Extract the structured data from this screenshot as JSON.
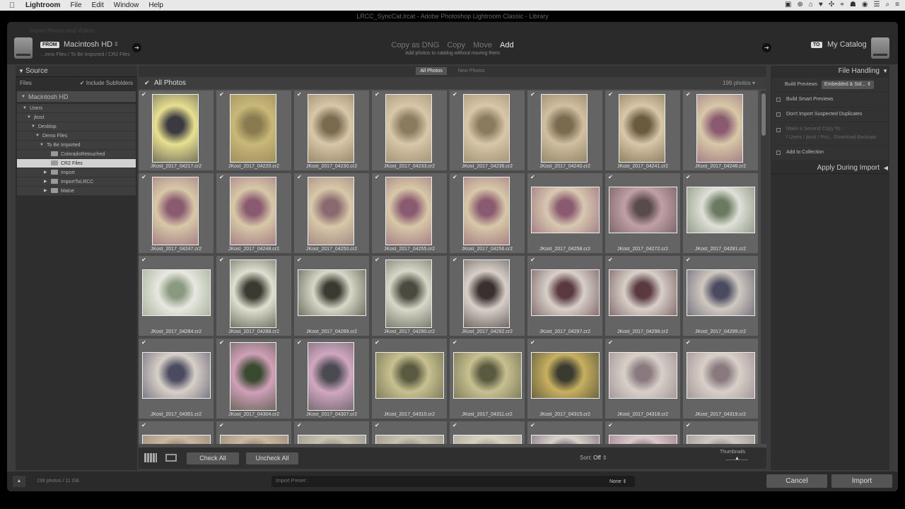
{
  "menubar": {
    "apple": "",
    "app": "Lightroom",
    "items": [
      "File",
      "Edit",
      "Window",
      "Help"
    ],
    "tray": [
      "▣",
      "⊕",
      "⌂",
      "♥",
      "✣",
      "⌖",
      "☗",
      "◉",
      "☰",
      "⌕",
      "≡"
    ]
  },
  "window_title": "LRCC_SyncCat.lrcat - Adobe Photoshop Lightroom Classic - Library",
  "header": {
    "faint_title": "Import Photos and Videos",
    "from_tag": "FROM",
    "from_source": "Macintosh HD",
    "from_path": "...emo Files / To Be Imported / CR2 Files",
    "modes": [
      "Copy as DNG",
      "Copy",
      "Move",
      "Add"
    ],
    "active_mode": "Add",
    "mode_sub": "Add photos to catalog without moving them",
    "to_tag": "TO",
    "to_target": "My Catalog"
  },
  "source": {
    "title": "Source",
    "files_label": "Files",
    "include_subfolders": "Include Subfolders",
    "drive": "Macintosh HD",
    "tree": [
      {
        "label": "Users",
        "level": 1,
        "open": true,
        "folder": false,
        "selected": false
      },
      {
        "label": "jkost",
        "level": 2,
        "open": true,
        "folder": false,
        "selected": false
      },
      {
        "label": "Desktop",
        "level": 3,
        "open": true,
        "folder": false,
        "selected": false
      },
      {
        "label": "Demo Files",
        "level": 4,
        "open": true,
        "folder": false,
        "selected": false
      },
      {
        "label": "To Be Imported",
        "level": 5,
        "open": true,
        "folder": false,
        "selected": false
      },
      {
        "label": "ColoradoRetouched",
        "level": 6,
        "open": false,
        "folder": true,
        "selected": false
      },
      {
        "label": "CR2 Files",
        "level": 6,
        "open": false,
        "folder": true,
        "selected": true
      },
      {
        "label": "Import",
        "level": 6,
        "open": false,
        "folder": true,
        "selected": false,
        "expandable": true
      },
      {
        "label": "ImportToLRCC",
        "level": 6,
        "open": false,
        "folder": true,
        "selected": false,
        "expandable": true
      },
      {
        "label": "Maine",
        "level": 6,
        "open": false,
        "folder": true,
        "selected": false,
        "expandable": true
      }
    ]
  },
  "center": {
    "tab_all": "All Photos",
    "tab_new": "New Photos",
    "section_title": "All Photos",
    "count": "199 photos",
    "check_mark": "✔",
    "photos": [
      {
        "name": "JKost_2017_04217.cr2",
        "o": "p",
        "c1": "#e8e090",
        "c2": "#3a3a40"
      },
      {
        "name": "JKost_2017_04220.cr2",
        "o": "p",
        "c1": "#c8b878",
        "c2": "#8a7a50"
      },
      {
        "name": "JKost_2017_04230.cr2",
        "o": "p",
        "c1": "#d8c8a8",
        "c2": "#7a6a50"
      },
      {
        "name": "JKost_2017_04233.cr2",
        "o": "p",
        "c1": "#d8c8a8",
        "c2": "#8a7a60"
      },
      {
        "name": "JKost_2017_04236.cr2",
        "o": "p",
        "c1": "#d8c8a8",
        "c2": "#8a7a60"
      },
      {
        "name": "JKost_2017_04240.cr2",
        "o": "p",
        "c1": "#d0c0a0",
        "c2": "#7a6a50"
      },
      {
        "name": "JKost_2017_04241.cr2",
        "o": "p",
        "c1": "#d8c8a8",
        "c2": "#6a5a40"
      },
      {
        "name": "JKost_2017_04246.cr2",
        "o": "p",
        "c1": "#d8c8a8",
        "c2": "#8a5a70"
      },
      {
        "name": "JKost_2017_04247.cr2",
        "o": "p",
        "c1": "#d8c8a8",
        "c2": "#8a5a70"
      },
      {
        "name": "JKost_2017_04248.cr2",
        "o": "p",
        "c1": "#d8c8a8",
        "c2": "#8a5a70"
      },
      {
        "name": "JKost_2017_04250.cr2",
        "o": "p",
        "c1": "#d8c8a8",
        "c2": "#8a6a70"
      },
      {
        "name": "JKost_2017_04255.cr2",
        "o": "p",
        "c1": "#d8c8a8",
        "c2": "#8a5a70"
      },
      {
        "name": "JKost_2017_04256.cr2",
        "o": "p",
        "c1": "#d8c8a8",
        "c2": "#8a5a70"
      },
      {
        "name": "JKost_2017_04258.cr2",
        "o": "l",
        "c1": "#d8c8b0",
        "c2": "#8a5a70"
      },
      {
        "name": "JKost_2017_04272.cr2",
        "o": "l",
        "c1": "#c0a0a8",
        "c2": "#5a4a4a"
      },
      {
        "name": "JKost_2017_04281.cr2",
        "o": "l",
        "c1": "#e0e0d8",
        "c2": "#6a7a60"
      },
      {
        "name": "JKost_2017_04284.cr2",
        "o": "l",
        "c1": "#e8e8e0",
        "c2": "#8a9a80"
      },
      {
        "name": "JKost_2017_04288.cr2",
        "o": "p",
        "c1": "#e0e0d0",
        "c2": "#3a3a30"
      },
      {
        "name": "JKost_2017_04289.cr2",
        "o": "l",
        "c1": "#d8d8c8",
        "c2": "#3a3a30"
      },
      {
        "name": "JKost_2017_04290.cr2",
        "o": "p",
        "c1": "#d8d8c8",
        "c2": "#4a4a40"
      },
      {
        "name": "JKost_2017_04292.cr2",
        "o": "p",
        "c1": "#d8d0c8",
        "c2": "#3a3030"
      },
      {
        "name": "JKost_2017_04297.cr2",
        "o": "l",
        "c1": "#d8d0c8",
        "c2": "#5a3a40"
      },
      {
        "name": "JKost_2017_04298.cr2",
        "o": "l",
        "c1": "#d8d0c8",
        "c2": "#5a3a40"
      },
      {
        "name": "JKost_2017_04299.cr2",
        "o": "l",
        "c1": "#d0c8c0",
        "c2": "#4a4a60"
      },
      {
        "name": "JKost_2017_04301.cr2",
        "o": "l",
        "c1": "#d8d0c8",
        "c2": "#4a4a60"
      },
      {
        "name": "JKost_2017_04304.cr2",
        "o": "p",
        "c1": "#d0a0b8",
        "c2": "#3a4a30"
      },
      {
        "name": "JKost_2017_04307.cr2",
        "o": "p",
        "c1": "#d0a8c0",
        "c2": "#4a4a50"
      },
      {
        "name": "JKost_2017_04310.cr2",
        "o": "l",
        "c1": "#c8c090",
        "c2": "#5a5a40"
      },
      {
        "name": "JKost_2017_04311.cr2",
        "o": "l",
        "c1": "#c8c090",
        "c2": "#5a5a40"
      },
      {
        "name": "JKost_2017_04315.cr2",
        "o": "l",
        "c1": "#c8b060",
        "c2": "#3a3a30"
      },
      {
        "name": "JKost_2017_04318.cr2",
        "o": "l",
        "c1": "#d8d0c8",
        "c2": "#8a7a80"
      },
      {
        "name": "JKost_2017_04319.cr2",
        "o": "l",
        "c1": "#d8d0c8",
        "c2": "#8a7a80"
      },
      {
        "name": "",
        "o": "l",
        "c1": "#c8b8a0",
        "c2": "#8a7a70"
      },
      {
        "name": "",
        "o": "l",
        "c1": "#c8b8a0",
        "c2": "#8a7a70"
      },
      {
        "name": "",
        "o": "l",
        "c1": "#c8c0b0",
        "c2": "#8a8a80"
      },
      {
        "name": "",
        "o": "l",
        "c1": "#c8c0b0",
        "c2": "#8a8a80"
      },
      {
        "name": "",
        "o": "l",
        "c1": "#d8d0c0",
        "c2": "#9a9a90"
      },
      {
        "name": "",
        "o": "l",
        "c1": "#d8d0c8",
        "c2": "#6a5a70"
      },
      {
        "name": "",
        "o": "l",
        "c1": "#d8c8c8",
        "c2": "#8a6a80"
      },
      {
        "name": "",
        "o": "l",
        "c1": "#d0c8c0",
        "c2": "#8a8a80"
      }
    ],
    "check_all": "Check All",
    "uncheck_all": "Uncheck All",
    "sort_label": "Sort:",
    "sort_value": "Off",
    "thumbnails_label": "Thumbnails"
  },
  "file_handling": {
    "title": "File Handling",
    "build_previews_label": "Build Previews",
    "build_previews_value": "Embedded & Sid...",
    "build_smart": "Build Smart Previews",
    "dont_import": "Don't Import Suspected Duplicates",
    "second_copy": "Make a Second Copy To :",
    "second_copy_path": "/ Users / jkost / Pict... Download Backups",
    "add_collection": "Add to Collection",
    "apply_during": "Apply During Import"
  },
  "footer": {
    "summary": "199 photos / 11 GB",
    "preset_label": "Import Preset :",
    "preset_value": "None",
    "cancel": "Cancel",
    "import": "Import"
  }
}
